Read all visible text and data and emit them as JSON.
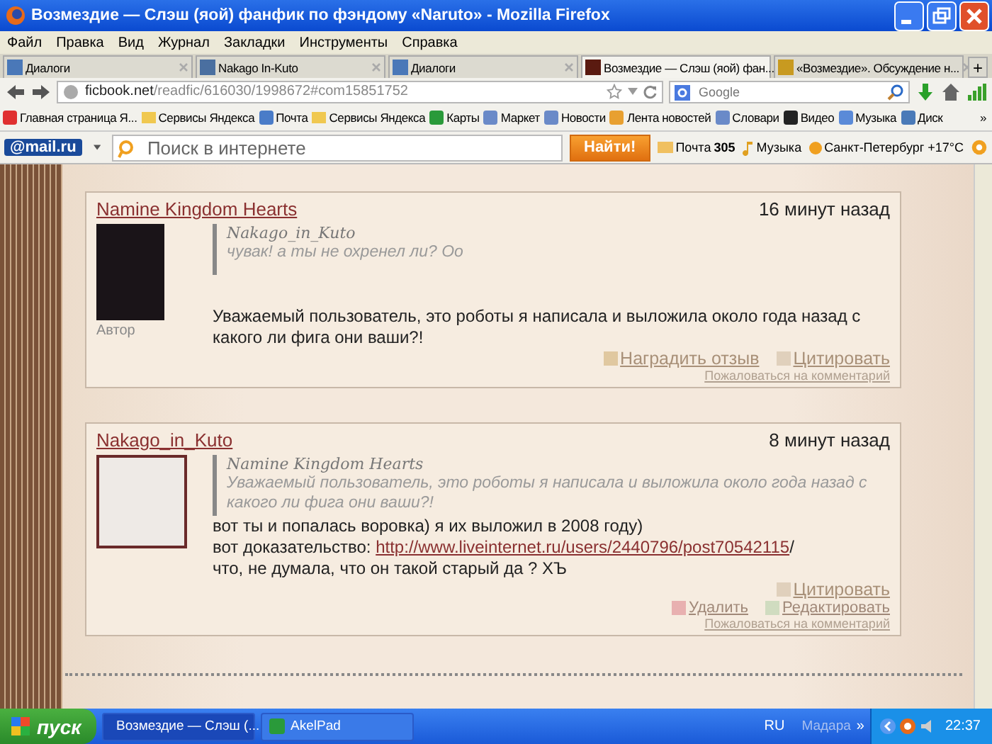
{
  "window": {
    "title": "Возмездие — Слэш (яой) фанфик по фэндому «Naruto» - Mozilla Firefox"
  },
  "menu": [
    "Файл",
    "Правка",
    "Вид",
    "Журнал",
    "Закладки",
    "Инструменты",
    "Справка"
  ],
  "tabs": [
    {
      "label": "Диалоги",
      "kind": "chat",
      "selected": false
    },
    {
      "label": "Nakago In-Kuto",
      "kind": "vk",
      "selected": false
    },
    {
      "label": "Диалоги",
      "kind": "chat",
      "selected": false
    },
    {
      "label": "Возмездие — Слэш (яой) фан...",
      "kind": "book",
      "selected": true
    },
    {
      "label": "«Возмездие». Обсуждение н...",
      "kind": "li",
      "selected": false
    }
  ],
  "new_tab": "+",
  "address": {
    "host": "ficbook.net",
    "path": "/readfic/616030/1998672#com15851752"
  },
  "search": {
    "placeholder": "Google"
  },
  "bookmarks": [
    {
      "label": "Главная страница Я...",
      "kind": "yandex"
    },
    {
      "label": "Сервисы Яндекса",
      "kind": "folder"
    },
    {
      "label": "Почта",
      "kind": "mail"
    },
    {
      "label": "Сервисы Яндекса",
      "kind": "folder"
    },
    {
      "label": "Карты",
      "kind": "map"
    },
    {
      "label": "Маркет",
      "kind": "page"
    },
    {
      "label": "Новости",
      "kind": "page"
    },
    {
      "label": "Лента новостей",
      "kind": "rss"
    },
    {
      "label": "Словари",
      "kind": "page"
    },
    {
      "label": "Видео",
      "kind": "video"
    },
    {
      "label": "Музыка",
      "kind": "sound"
    },
    {
      "label": "Диск",
      "kind": "disk"
    }
  ],
  "bookmarks_more": "»",
  "mailru": {
    "logo": "@mail.ru",
    "placeholder": "Поиск в интернете",
    "button": "Найти!",
    "mail": "Почта",
    "mail_count": "305",
    "music": "Музыка",
    "weather": "Санкт-Петербург +17°C"
  },
  "comments": [
    {
      "author": "Namine Kingdom Hearts",
      "time": "16 минут назад",
      "role": "Автор",
      "quote_author": "Nakago_in_Kuto",
      "quote_text": "чувак! а ты не охренел ли? Оо",
      "body": [
        {
          "text": "Уважаемый пользователь, это роботы я написала и выложила около года назад с какого ли фига они ваши?!"
        }
      ],
      "actions": [
        {
          "label": "Наградить отзыв",
          "kind": "award"
        },
        {
          "label": "Цитировать",
          "kind": "quote"
        }
      ],
      "report": "Пожаловаться на комментарий"
    },
    {
      "author": "Nakago_in_Kuto",
      "time": "8 минут назад",
      "quote_author": "Namine Kingdom Hearts",
      "quote_text": "Уважаемый пользователь, это роботы я написала и выложила около года назад с какого ли фига они ваши?!",
      "body": [
        {
          "text": "вот ты и попалась воровка) я их выложил в 2008 году)"
        },
        {
          "text": "вот доказательство: ",
          "link": "http://www.liveinternet.ru/users/2440796/post70542115",
          "after": "/"
        },
        {
          "text": "что, не думала, что он такой старый да ? ХЪ"
        }
      ],
      "actions": [
        {
          "label": "Цитировать",
          "kind": "quote"
        }
      ],
      "actions2": [
        {
          "label": "Удалить",
          "kind": "delete"
        },
        {
          "label": "Редактировать",
          "kind": "edit"
        }
      ],
      "report": "Пожаловаться на комментарий"
    }
  ],
  "taskbar": {
    "start": "пуск",
    "tasks": [
      {
        "label": "Возмездие — Слэш (...",
        "kind": "firefox",
        "selected": true
      },
      {
        "label": "AkelPad",
        "kind": "notepad",
        "selected": false
      }
    ],
    "lang": "RU",
    "toolbar": "Мадара",
    "more": "»",
    "clock": "22:37"
  }
}
